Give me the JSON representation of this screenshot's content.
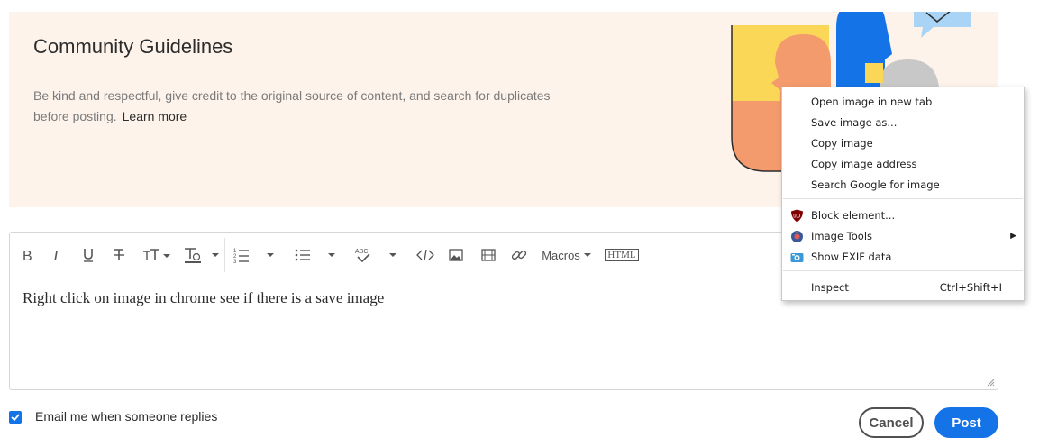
{
  "banner": {
    "title": "Community Guidelines",
    "text": "Be kind and respectful, give credit to the original source of content, and search for duplicates before posting.",
    "learn_more": "Learn more"
  },
  "toolbar": {
    "macros_label": "Macros",
    "html_label": "HTML",
    "icons": [
      "bold-icon",
      "italic-icon",
      "underline-icon",
      "strikethrough-icon",
      "font-size-icon",
      "text-color-icon",
      "numbered-list-icon",
      "bulleted-list-icon",
      "spellcheck-icon",
      "code-icon",
      "image-icon",
      "video-icon",
      "link-icon"
    ]
  },
  "editor": {
    "content": "Right click on image in chrome see if there is a save image"
  },
  "footer": {
    "email_label": "Email me when someone replies",
    "email_checked": true,
    "cancel_label": "Cancel",
    "post_label": "Post"
  },
  "context_menu": {
    "items": [
      {
        "label": "Open image in new tab"
      },
      {
        "label": "Save image as..."
      },
      {
        "label": "Copy image"
      },
      {
        "label": "Copy image address"
      },
      {
        "label": "Search Google for image"
      },
      {
        "label": "Block element..."
      },
      {
        "label": "Image Tools"
      },
      {
        "label": "Show EXIF data"
      },
      {
        "label": "Inspect",
        "shortcut": "Ctrl+Shift+I"
      }
    ]
  },
  "colors": {
    "accent": "#1473e6",
    "banner_bg": "#fdf3eb"
  }
}
